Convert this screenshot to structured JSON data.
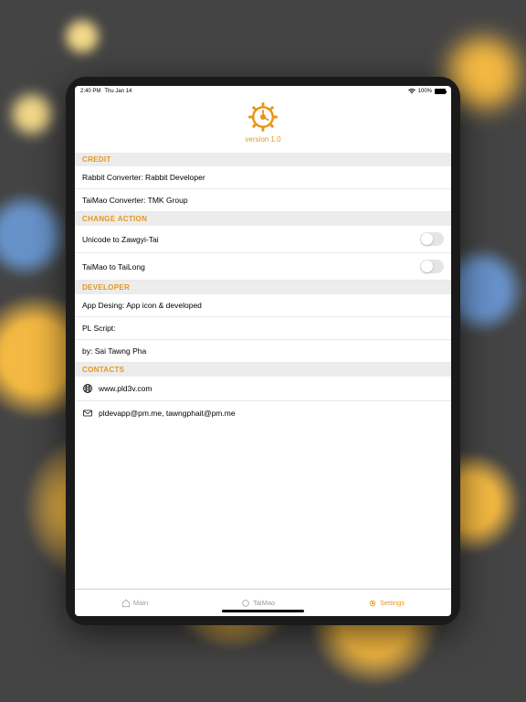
{
  "status": {
    "time": "2:40 PM",
    "date": "Thu Jan 14",
    "battery_pct": "100%"
  },
  "header": {
    "version": "version 1.0"
  },
  "accent": "#e8951a",
  "sections": {
    "credit": {
      "title": "CREDIT",
      "rows": [
        "Rabbit Converter: Rabbit Developer",
        "TaiMao Converter: TMK Group"
      ]
    },
    "change_action": {
      "title": "CHANGE ACTION",
      "rows": [
        "Unicode to Zawgyi-Tai",
        "TaiMao to TaiLong"
      ]
    },
    "developer": {
      "title": "DEVELOPER",
      "rows": [
        "App Desing: App icon & developed",
        "PL Script:",
        "by: Sai Tawng Pha"
      ]
    },
    "contacts": {
      "title": "CONTACTS",
      "website": "www.pld3v.com",
      "email": "pldevapp@pm.me, tawngphait@pm.me"
    }
  },
  "tabs": {
    "main": "Main",
    "taimao": "TaiMao",
    "settings": "Settings"
  }
}
